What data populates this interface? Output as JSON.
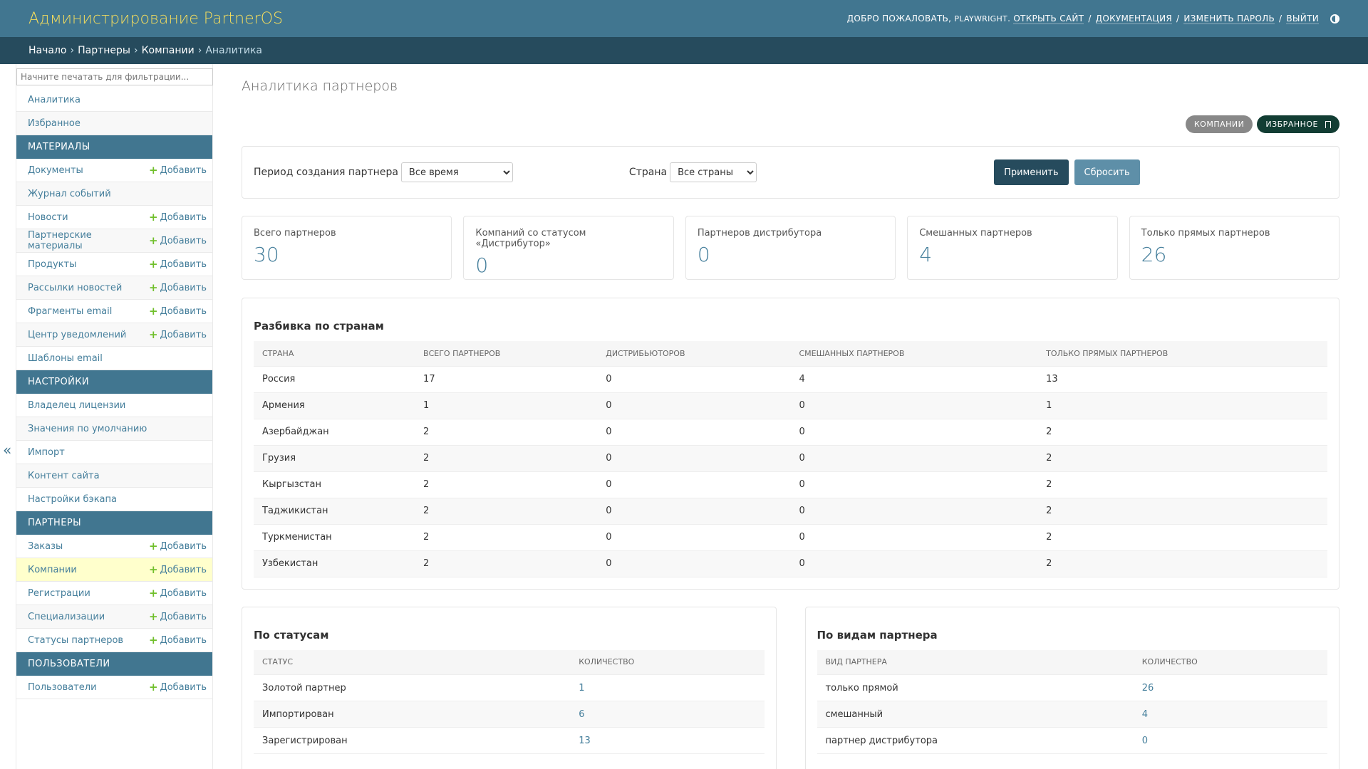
{
  "header": {
    "site_name": "Администрирование PartnerOS",
    "welcome": "ДОБРО ПОЖАЛОВАТЬ,",
    "username": "PLAYWRIGHT",
    "view_site": "ОТКРЫТЬ САЙТ",
    "docs": "ДОКУМЕНТАЦИЯ",
    "change_password": "ИЗМЕНИТЬ ПАРОЛЬ",
    "logout": "ВЫЙТИ",
    "sep": "/"
  },
  "breadcrumbs": {
    "home": "Начало",
    "partners": "Партнеры",
    "companies": "Компании",
    "current": "Аналитика",
    "arrow": "›"
  },
  "sidebar": {
    "filter_placeholder": "Начните печатать для фильтрации...",
    "toggle": "«",
    "add_label": "Добавить",
    "top": [
      {
        "label": "Аналитика"
      },
      {
        "label": "Избранное"
      }
    ],
    "materials": {
      "title": "МАТЕРИАЛЫ",
      "items": [
        {
          "label": "Документы"
        },
        {
          "label": "Журнал событий"
        },
        {
          "label": "Новости"
        },
        {
          "label": "Партнерские материалы"
        },
        {
          "label": "Продукты"
        },
        {
          "label": "Рассылки новостей"
        },
        {
          "label": "Фрагменты email"
        },
        {
          "label": "Центр уведомлений"
        },
        {
          "label": "Шаблоны email"
        }
      ]
    },
    "settings": {
      "title": "НАСТРОЙКИ",
      "items": [
        {
          "label": "Владелец лицензии"
        },
        {
          "label": "Значения по умолчанию"
        },
        {
          "label": "Импорт"
        },
        {
          "label": "Контент сайта"
        },
        {
          "label": "Настройки бэкапа"
        }
      ]
    },
    "partners": {
      "title": "ПАРТНЕРЫ",
      "items": [
        {
          "label": "Заказы"
        },
        {
          "label": "Компании"
        },
        {
          "label": "Регистрации"
        },
        {
          "label": "Специализации"
        },
        {
          "label": "Статусы партнеров"
        }
      ]
    },
    "users": {
      "title": "ПОЛЬЗОВАТЕЛИ",
      "items": [
        {
          "label": "Пользователи"
        }
      ]
    }
  },
  "page": {
    "title": "Аналитика партнеров",
    "tool_companies": "КОМПАНИИ",
    "tool_favorites": "ИЗБРАННОЕ"
  },
  "filters": {
    "period_label": "Период создания партнера",
    "period_value": "Все время",
    "country_label": "Страна",
    "country_value": "Все страны",
    "apply": "Применить",
    "reset": "Сбросить"
  },
  "stats": [
    {
      "label": "Всего партнеров",
      "value": "30"
    },
    {
      "label": "Компаний со статусом «Дистрибутор»",
      "value": "0"
    },
    {
      "label": "Партнеров дистрибутора",
      "value": "0"
    },
    {
      "label": "Смешанных партнеров",
      "value": "4"
    },
    {
      "label": "Только прямых партнеров",
      "value": "26"
    }
  ],
  "countries": {
    "title": "Разбивка по странам",
    "headers": [
      "СТРАНА",
      "ВСЕГО ПАРТНЕРОВ",
      "ДИСТРИБЬЮТОРОВ",
      "СМЕШАННЫХ ПАРТНЕРОВ",
      "ТОЛЬКО ПРЯМЫХ ПАРТНЕРОВ"
    ],
    "rows": [
      [
        "Россия",
        "17",
        "0",
        "4",
        "13"
      ],
      [
        "Армения",
        "1",
        "0",
        "0",
        "1"
      ],
      [
        "Азербайджан",
        "2",
        "0",
        "0",
        "2"
      ],
      [
        "Грузия",
        "2",
        "0",
        "0",
        "2"
      ],
      [
        "Кыргызстан",
        "2",
        "0",
        "0",
        "2"
      ],
      [
        "Таджикистан",
        "2",
        "0",
        "0",
        "2"
      ],
      [
        "Туркменистан",
        "2",
        "0",
        "0",
        "2"
      ],
      [
        "Узбекистан",
        "2",
        "0",
        "0",
        "2"
      ]
    ]
  },
  "statuses": {
    "title": "По статусам",
    "headers": [
      "СТАТУС",
      "КОЛИЧЕСТВО"
    ],
    "rows": [
      [
        "Золотой партнер",
        "1"
      ],
      [
        "Импортирован",
        "6"
      ],
      [
        "Зарегистрирован",
        "13"
      ]
    ]
  },
  "kinds": {
    "title": "По видам партнера",
    "headers": [
      "ВИД ПАРТНЕРА",
      "КОЛИЧЕСТВО"
    ],
    "rows": [
      [
        "только прямой",
        "26"
      ],
      [
        "смешанный",
        "4"
      ],
      [
        "партнер дистрибутора",
        "0"
      ]
    ]
  },
  "colors": {
    "header_bg": "#417690",
    "breadcrumb_bg": "#264b5d",
    "site_name": "#f5dd5d",
    "link": "#447e9b",
    "add_plus": "#70bf2b",
    "current_row": "#ffffcc"
  }
}
